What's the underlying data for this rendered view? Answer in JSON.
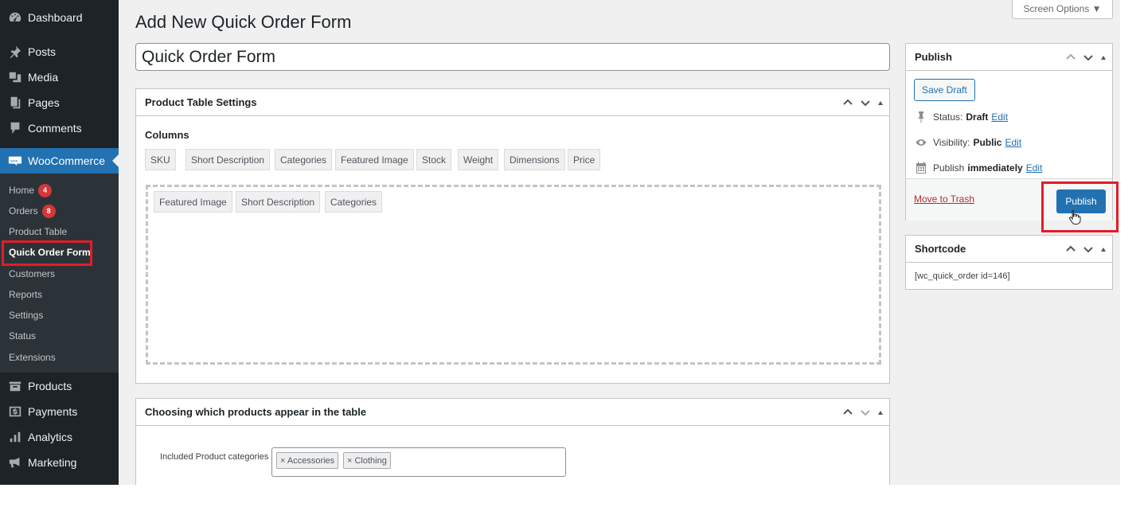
{
  "sidebar": {
    "top_items": [
      {
        "label": "Dashboard",
        "icon": "dashboard-icon"
      },
      {
        "label": "Posts",
        "icon": "pin-icon"
      },
      {
        "label": "Media",
        "icon": "media-icon"
      },
      {
        "label": "Pages",
        "icon": "pages-icon"
      },
      {
        "label": "Comments",
        "icon": "comment-icon"
      }
    ],
    "woocommerce": {
      "label": "WooCommerce",
      "icon": "woo-icon"
    },
    "submenu": [
      {
        "label": "Home",
        "badge": "4"
      },
      {
        "label": "Orders",
        "badge": "8"
      },
      {
        "label": "Product Table"
      },
      {
        "label": "Quick Order Form",
        "current": true
      },
      {
        "label": "Customers"
      },
      {
        "label": "Reports"
      },
      {
        "label": "Settings"
      },
      {
        "label": "Status"
      },
      {
        "label": "Extensions"
      }
    ],
    "bottom_items": [
      {
        "label": "Products",
        "icon": "archive-icon"
      },
      {
        "label": "Payments",
        "icon": "money-icon"
      },
      {
        "label": "Analytics",
        "icon": "chart-bar-icon"
      },
      {
        "label": "Marketing",
        "icon": "megaphone-icon"
      }
    ]
  },
  "header": {
    "screen_options": "Screen Options ▼",
    "page_title": "Add New Quick Order Form"
  },
  "title_field": {
    "value": "Quick Order Form"
  },
  "product_table_settings": {
    "title": "Product Table Settings",
    "columns_label": "Columns",
    "available_columns": [
      "SKU",
      "Short Description",
      "Categories",
      "Featured Image",
      "Stock",
      "Weight",
      "Dimensions",
      "Price"
    ],
    "selected_columns": [
      "Featured Image",
      "Short Description",
      "Categories"
    ]
  },
  "choosing_products": {
    "title": "Choosing which products appear in the table",
    "categories_label": "Included Product categories",
    "categories": [
      "× Accessories",
      "× Clothing"
    ]
  },
  "publish": {
    "title": "Publish",
    "save_draft": "Save Draft",
    "status_label": "Status:",
    "status_value": "Draft",
    "visibility_label": "Visibility:",
    "visibility_value": "Public",
    "publish_label": "Publish",
    "publish_value": "immediately",
    "edit_label": "Edit",
    "move_to_trash": "Move to Trash",
    "publish_button": "Publish"
  },
  "shortcode": {
    "title": "Shortcode",
    "value": "[wc_quick_order id=146]"
  },
  "colors": {
    "sidebar_bg": "#1d2327",
    "submenu_bg": "#2c3338",
    "accent": "#2271b1",
    "highlight": "#e11e27",
    "badge": "#d63638"
  }
}
